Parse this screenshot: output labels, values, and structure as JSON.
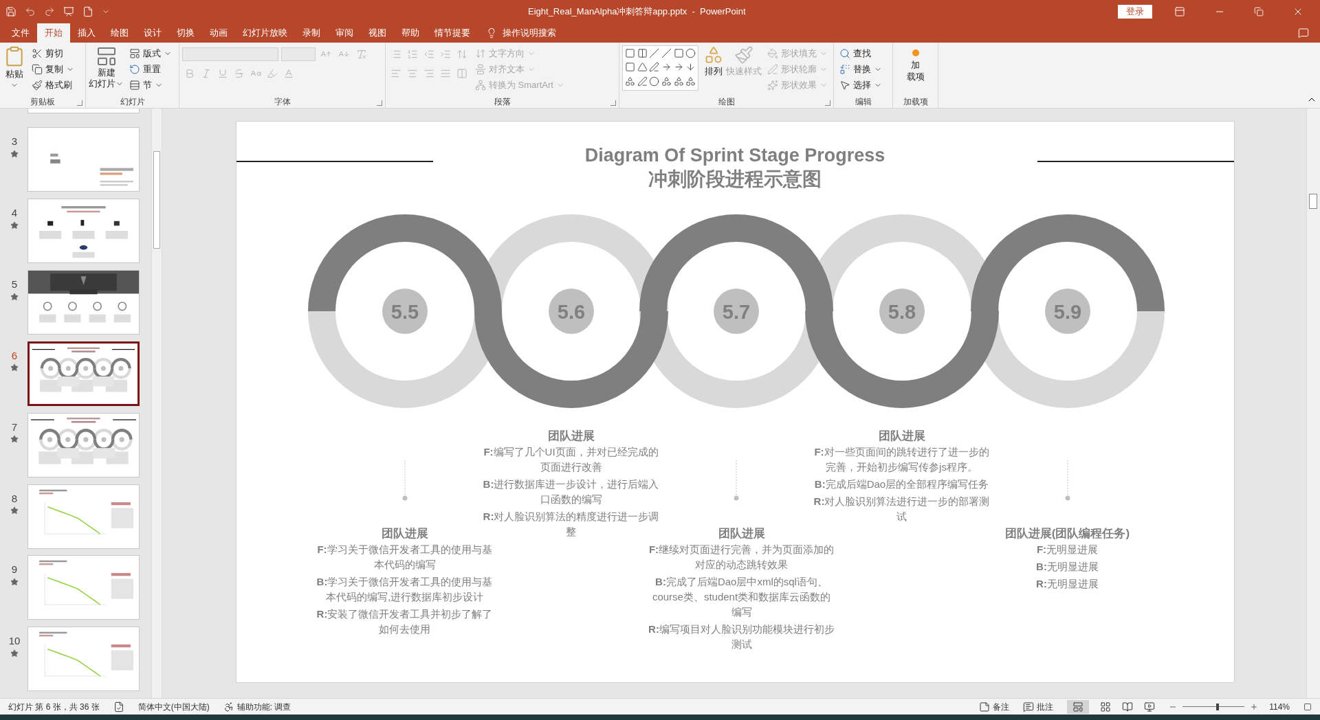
{
  "window": {
    "title": "Eight_Real_ManAlpha冲刺答辩app.pptx  -  PowerPoint",
    "sign_in": "登录"
  },
  "tabs": [
    {
      "label": "文件",
      "selected": false
    },
    {
      "label": "开始",
      "selected": true
    },
    {
      "label": "插入",
      "selected": false
    },
    {
      "label": "绘图",
      "selected": false
    },
    {
      "label": "设计",
      "selected": false
    },
    {
      "label": "切换",
      "selected": false
    },
    {
      "label": "动画",
      "selected": false
    },
    {
      "label": "幻灯片放映",
      "selected": false
    },
    {
      "label": "录制",
      "selected": false
    },
    {
      "label": "审阅",
      "selected": false
    },
    {
      "label": "视图",
      "selected": false
    },
    {
      "label": "帮助",
      "selected": false
    },
    {
      "label": "情节提要",
      "selected": false
    }
  ],
  "tell_me": "操作说明搜索",
  "ribbon": {
    "clipboard": {
      "paste": "粘贴",
      "cut": "剪切",
      "copy": "复制",
      "format_painter": "格式刷",
      "label": "剪贴板"
    },
    "slides": {
      "new_slide": [
        "新建",
        "幻灯片"
      ],
      "layout": "版式",
      "reset": "重置",
      "section": "节",
      "label": "幻灯片"
    },
    "font": {
      "label": "字体"
    },
    "paragraph": {
      "items": [
        {
          "label": "文字方向",
          "disabled": true
        },
        {
          "label": "对齐文本",
          "disabled": true
        },
        {
          "label": "转换为 SmartArt",
          "disabled": true
        }
      ],
      "label": "段落"
    },
    "drawing": {
      "arrange": "排列",
      "quick_styles": {
        "label": "快速样式",
        "disabled": true
      },
      "items": [
        {
          "label": "形状填充",
          "disabled": true
        },
        {
          "label": "形状轮廓",
          "disabled": true
        },
        {
          "label": "形状效果",
          "disabled": true
        }
      ],
      "label": "绘图"
    },
    "editing": {
      "find": "查找",
      "replace": "替换",
      "select": "选择",
      "label": "编辑"
    },
    "addins": {
      "button": [
        "加",
        "载项"
      ],
      "label": "加载项"
    }
  },
  "thumbnails": [
    {
      "number": "3",
      "kind": "part",
      "selected": false
    },
    {
      "number": "4",
      "kind": "icons",
      "selected": false
    },
    {
      "number": "5",
      "kind": "photo",
      "selected": false
    },
    {
      "number": "6",
      "kind": "rings",
      "selected": true
    },
    {
      "number": "7",
      "kind": "rings",
      "selected": false
    },
    {
      "number": "8",
      "kind": "chart",
      "selected": false
    },
    {
      "number": "9",
      "kind": "chart",
      "selected": false
    },
    {
      "number": "10",
      "kind": "chart",
      "selected": false
    }
  ],
  "slide": {
    "title": "Diagram Of Sprint Stage Progress",
    "subtitle": "冲刺阶段进程示意图",
    "stages": [
      "5.5",
      "5.6",
      "5.7",
      "5.8",
      "5.9"
    ],
    "notes": [
      {
        "title": "团队进展",
        "items": [
          "**F:**学习关于微信开发者工具的使用与基本代码的编写",
          "**B:**学习关于微信开发者工具的使用与基本代码的编写,进行数据库初步设计",
          "**R:**安装了微信开发者工具并初步了解了如何去使用"
        ]
      },
      {
        "title": "团队进展",
        "items": [
          "**F:**编写了几个UI页面，并对已经完成的页面进行改善",
          "**B:**进行数据库进一步设计，进行后端入口函数的编写",
          "**R:**对人脸识别算法的精度进行进一步调整"
        ]
      },
      {
        "title": "团队进展",
        "items": [
          "**F:**继续对页面进行完善，并为页面添加的对应的动态跳转效果",
          "**B:**完成了后端Dao层中xml的sql语句、course类、student类和数据库云函数的编写",
          "**R:**编写项目对人脸识别功能模块进行初步测试"
        ]
      },
      {
        "title": "团队进展",
        "items": [
          "**F:**对一些页面间的跳转进行了进一步的完善，开始初步编写传参js程序。",
          "**B:**完成后端Dao层的全部程序编写任务",
          "**R:**对人脸识别算法进行进一步的部署测试"
        ]
      },
      {
        "title": "团队进展(团队编程任务)",
        "items": [
          "**F:**无明显进展",
          "**B:**无明显进展",
          "**R:**无明显进展"
        ]
      }
    ]
  },
  "status_bar": {
    "slide_count": "幻灯片 第 6 张，共 36 张",
    "language": "简体中文(中国大陆)",
    "accessibility": "辅助功能: 调查",
    "notes": "备注",
    "comments": "批注",
    "zoom": "114%",
    "zoom_slider": {
      "level": 0.57
    }
  }
}
